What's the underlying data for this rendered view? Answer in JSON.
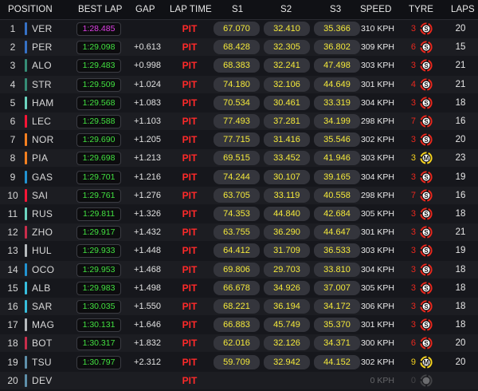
{
  "headers": {
    "position": "POSITION",
    "best_lap": "BEST LAP",
    "gap": "GAP",
    "lap_time": "LAP TIME",
    "s1": "S1",
    "s2": "S2",
    "s3": "S3",
    "speed": "SPEED",
    "tyre": "TYRE",
    "laps": "LAPS"
  },
  "colors": {
    "fastest_lap": "#e040e8",
    "personal_lap": "#42e040",
    "sector": "#f5ea3a",
    "pit": "#ff2a2a",
    "tyre_soft": "#e8281e",
    "tyre_medium": "#f5d21e"
  },
  "rows": [
    {
      "pos": "1",
      "driver": "VER",
      "team_color": "#3671c6",
      "best_lap": "1:28.485",
      "best_type": "fastest",
      "gap": "",
      "lap_time": "PIT",
      "s1": "67.070",
      "s2": "32.410",
      "s3": "35.366",
      "speed": "310 KPH",
      "tyre_age": "3",
      "tyre": "S",
      "laps": "20"
    },
    {
      "pos": "2",
      "driver": "PER",
      "team_color": "#3671c6",
      "best_lap": "1:29.098",
      "best_type": "personal",
      "gap": "+0.613",
      "lap_time": "PIT",
      "s1": "68.428",
      "s2": "32.305",
      "s3": "36.802",
      "speed": "309 KPH",
      "tyre_age": "6",
      "tyre": "S",
      "laps": "15"
    },
    {
      "pos": "3",
      "driver": "ALO",
      "team_color": "#358c75",
      "best_lap": "1:29.483",
      "best_type": "personal",
      "gap": "+0.998",
      "lap_time": "PIT",
      "s1": "68.383",
      "s2": "32.241",
      "s3": "47.498",
      "speed": "303 KPH",
      "tyre_age": "3",
      "tyre": "S",
      "laps": "21"
    },
    {
      "pos": "4",
      "driver": "STR",
      "team_color": "#358c75",
      "best_lap": "1:29.509",
      "best_type": "personal",
      "gap": "+1.024",
      "lap_time": "PIT",
      "s1": "74.180",
      "s2": "32.106",
      "s3": "44.649",
      "speed": "301 KPH",
      "tyre_age": "4",
      "tyre": "S",
      "laps": "21"
    },
    {
      "pos": "5",
      "driver": "HAM",
      "team_color": "#6cd3bf",
      "best_lap": "1:29.568",
      "best_type": "personal",
      "gap": "+1.083",
      "lap_time": "PIT",
      "s1": "70.534",
      "s2": "30.461",
      "s3": "33.319",
      "speed": "304 KPH",
      "tyre_age": "3",
      "tyre": "S",
      "laps": "18"
    },
    {
      "pos": "6",
      "driver": "LEC",
      "team_color": "#f91536",
      "best_lap": "1:29.588",
      "best_type": "personal",
      "gap": "+1.103",
      "lap_time": "PIT",
      "s1": "77.493",
      "s2": "37.281",
      "s3": "34.199",
      "speed": "298 KPH",
      "tyre_age": "7",
      "tyre": "S",
      "laps": "16"
    },
    {
      "pos": "7",
      "driver": "NOR",
      "team_color": "#f58020",
      "best_lap": "1:29.690",
      "best_type": "personal",
      "gap": "+1.205",
      "lap_time": "PIT",
      "s1": "77.715",
      "s2": "31.416",
      "s3": "35.546",
      "speed": "302 KPH",
      "tyre_age": "3",
      "tyre": "S",
      "laps": "20"
    },
    {
      "pos": "8",
      "driver": "PIA",
      "team_color": "#f58020",
      "best_lap": "1:29.698",
      "best_type": "personal",
      "gap": "+1.213",
      "lap_time": "PIT",
      "s1": "69.515",
      "s2": "33.452",
      "s3": "41.946",
      "speed": "303 KPH",
      "tyre_age": "3",
      "tyre": "M",
      "laps": "23"
    },
    {
      "pos": "9",
      "driver": "GAS",
      "team_color": "#2293d1",
      "best_lap": "1:29.701",
      "best_type": "personal",
      "gap": "+1.216",
      "lap_time": "PIT",
      "s1": "74.244",
      "s2": "30.107",
      "s3": "39.165",
      "speed": "304 KPH",
      "tyre_age": "3",
      "tyre": "S",
      "laps": "19"
    },
    {
      "pos": "10",
      "driver": "SAI",
      "team_color": "#f91536",
      "best_lap": "1:29.761",
      "best_type": "personal",
      "gap": "+1.276",
      "lap_time": "PIT",
      "s1": "63.705",
      "s2": "33.119",
      "s3": "40.558",
      "speed": "298 KPH",
      "tyre_age": "7",
      "tyre": "S",
      "laps": "16"
    },
    {
      "pos": "11",
      "driver": "RUS",
      "team_color": "#6cd3bf",
      "best_lap": "1:29.811",
      "best_type": "personal",
      "gap": "+1.326",
      "lap_time": "PIT",
      "s1": "74.353",
      "s2": "44.840",
      "s3": "42.684",
      "speed": "305 KPH",
      "tyre_age": "3",
      "tyre": "S",
      "laps": "18"
    },
    {
      "pos": "12",
      "driver": "ZHO",
      "team_color": "#c92d4b",
      "best_lap": "1:29.917",
      "best_type": "personal",
      "gap": "+1.432",
      "lap_time": "PIT",
      "s1": "63.755",
      "s2": "36.290",
      "s3": "44.647",
      "speed": "301 KPH",
      "tyre_age": "3",
      "tyre": "S",
      "laps": "21"
    },
    {
      "pos": "13",
      "driver": "HUL",
      "team_color": "#b6babd",
      "best_lap": "1:29.933",
      "best_type": "personal",
      "gap": "+1.448",
      "lap_time": "PIT",
      "s1": "64.412",
      "s2": "31.709",
      "s3": "36.533",
      "speed": "303 KPH",
      "tyre_age": "3",
      "tyre": "S",
      "laps": "19"
    },
    {
      "pos": "14",
      "driver": "OCO",
      "team_color": "#2293d1",
      "best_lap": "1:29.953",
      "best_type": "personal",
      "gap": "+1.468",
      "lap_time": "PIT",
      "s1": "69.806",
      "s2": "29.703",
      "s3": "33.810",
      "speed": "304 KPH",
      "tyre_age": "3",
      "tyre": "S",
      "laps": "18"
    },
    {
      "pos": "15",
      "driver": "ALB",
      "team_color": "#37bedd",
      "best_lap": "1:29.983",
      "best_type": "personal",
      "gap": "+1.498",
      "lap_time": "PIT",
      "s1": "66.678",
      "s2": "34.926",
      "s3": "37.007",
      "speed": "305 KPH",
      "tyre_age": "3",
      "tyre": "S",
      "laps": "18"
    },
    {
      "pos": "16",
      "driver": "SAR",
      "team_color": "#37bedd",
      "best_lap": "1:30.035",
      "best_type": "personal",
      "gap": "+1.550",
      "lap_time": "PIT",
      "s1": "68.221",
      "s2": "36.194",
      "s3": "34.172",
      "speed": "306 KPH",
      "tyre_age": "3",
      "tyre": "S",
      "laps": "18"
    },
    {
      "pos": "17",
      "driver": "MAG",
      "team_color": "#b6babd",
      "best_lap": "1:30.131",
      "best_type": "personal",
      "gap": "+1.646",
      "lap_time": "PIT",
      "s1": "66.883",
      "s2": "45.749",
      "s3": "35.370",
      "speed": "301 KPH",
      "tyre_age": "3",
      "tyre": "S",
      "laps": "18"
    },
    {
      "pos": "18",
      "driver": "BOT",
      "team_color": "#c92d4b",
      "best_lap": "1:30.317",
      "best_type": "personal",
      "gap": "+1.832",
      "lap_time": "PIT",
      "s1": "62.016",
      "s2": "32.126",
      "s3": "34.371",
      "speed": "300 KPH",
      "tyre_age": "6",
      "tyre": "S",
      "laps": "20"
    },
    {
      "pos": "19",
      "driver": "TSU",
      "team_color": "#5e8faa",
      "best_lap": "1:30.797",
      "best_type": "personal",
      "gap": "+2.312",
      "lap_time": "PIT",
      "s1": "59.709",
      "s2": "32.942",
      "s3": "44.152",
      "speed": "302 KPH",
      "tyre_age": "9",
      "tyre": "M",
      "laps": "20"
    },
    {
      "pos": "20",
      "driver": "DEV",
      "team_color": "#5e8faa",
      "best_lap": "",
      "best_type": "none",
      "gap": "",
      "lap_time": "PIT",
      "s1": "",
      "s2": "",
      "s3": "",
      "speed": "0 KPH",
      "tyre_age": "0",
      "tyre": "",
      "laps": ""
    }
  ]
}
